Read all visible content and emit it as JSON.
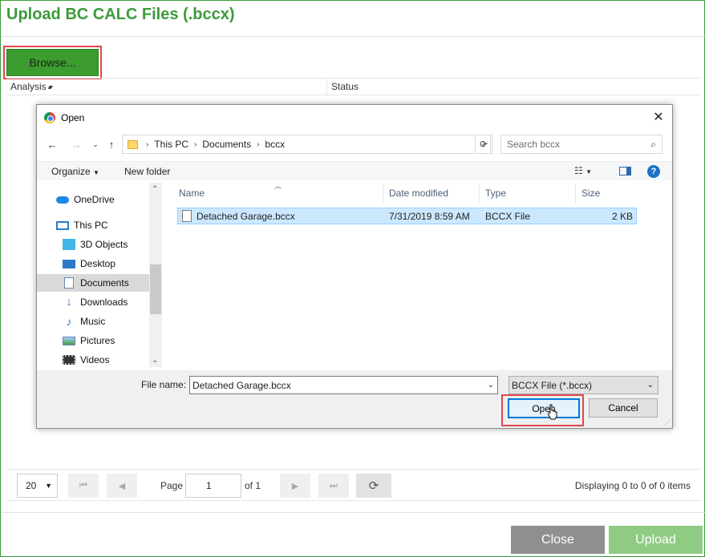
{
  "page": {
    "title": "Upload BC CALC Files (.bccx)",
    "browse_label": "Browse...",
    "grid": {
      "columns": [
        "Analysis",
        "Status"
      ],
      "sort_glyph": "▴▾"
    },
    "pager": {
      "page_size": "20",
      "page_label": "Page",
      "page_value": "1",
      "of_label": "of 1",
      "display_text": "Displaying 0 to 0 of 0 items"
    },
    "buttons": {
      "close": "Close",
      "upload": "Upload"
    }
  },
  "dialog": {
    "title": "Open",
    "breadcrumb": [
      "This PC",
      "Documents",
      "bccx"
    ],
    "search_placeholder": "Search bccx",
    "toolbar": {
      "organize": "Organize",
      "new_folder": "New folder"
    },
    "nav_items": [
      {
        "label": "OneDrive",
        "icon": "cloud-icon"
      },
      {
        "label": "This PC",
        "icon": "computer-icon"
      },
      {
        "label": "3D Objects",
        "icon": "cube-icon"
      },
      {
        "label": "Desktop",
        "icon": "desktop-icon"
      },
      {
        "label": "Documents",
        "icon": "document-icon"
      },
      {
        "label": "Downloads",
        "icon": "download-icon"
      },
      {
        "label": "Music",
        "icon": "music-icon"
      },
      {
        "label": "Pictures",
        "icon": "pictures-icon"
      },
      {
        "label": "Videos",
        "icon": "video-icon"
      }
    ],
    "file_columns": [
      "Name",
      "Date modified",
      "Type",
      "Size"
    ],
    "files": [
      {
        "name": "Detached Garage.bccx",
        "date": "7/31/2019 8:59 AM",
        "type": "BCCX File",
        "size": "2 KB"
      }
    ],
    "file_name_label": "File name:",
    "file_name_value": "Detached Garage.bccx",
    "file_type_value": "BCCX File (*.bccx)",
    "open_label": "Open",
    "cancel_label": "Cancel"
  },
  "colors": {
    "accent_green": "#3b9b3b",
    "highlight_red": "#e0474c",
    "selection_blue": "#cce8ff"
  }
}
